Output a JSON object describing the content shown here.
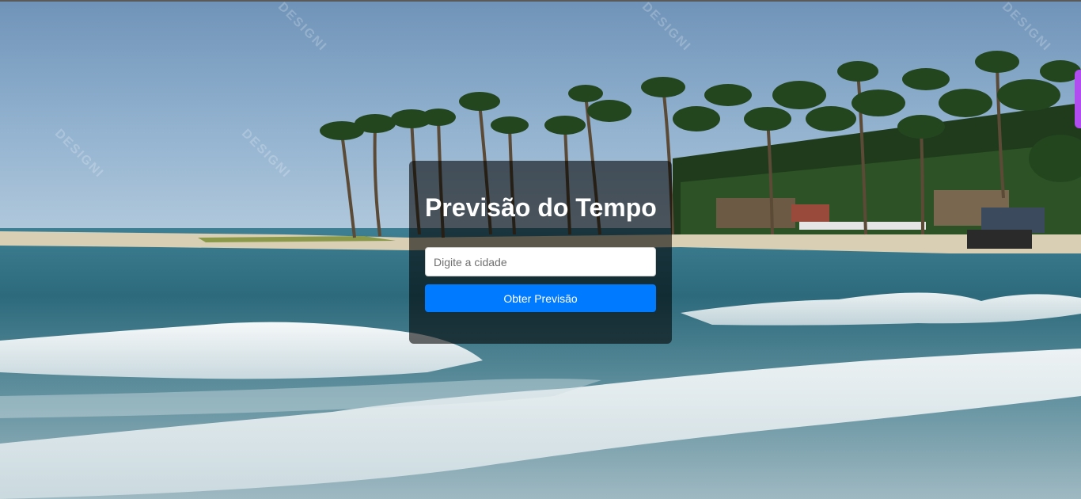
{
  "page": {
    "title": "Previsão do Tempo"
  },
  "form": {
    "city_placeholder": "Digite a cidade",
    "city_value": "",
    "submit_label": "Obter Previsão"
  },
  "background": {
    "watermark_text": "DESIGNI",
    "colors": {
      "sky": "#8fb0cf",
      "sea": "#2f6d7e",
      "foam": "#eef3f4",
      "palm": "#23461f",
      "card": "rgba(0,0,0,0.58)",
      "button": "#007bff",
      "side_tab": "#b04cf0"
    }
  }
}
